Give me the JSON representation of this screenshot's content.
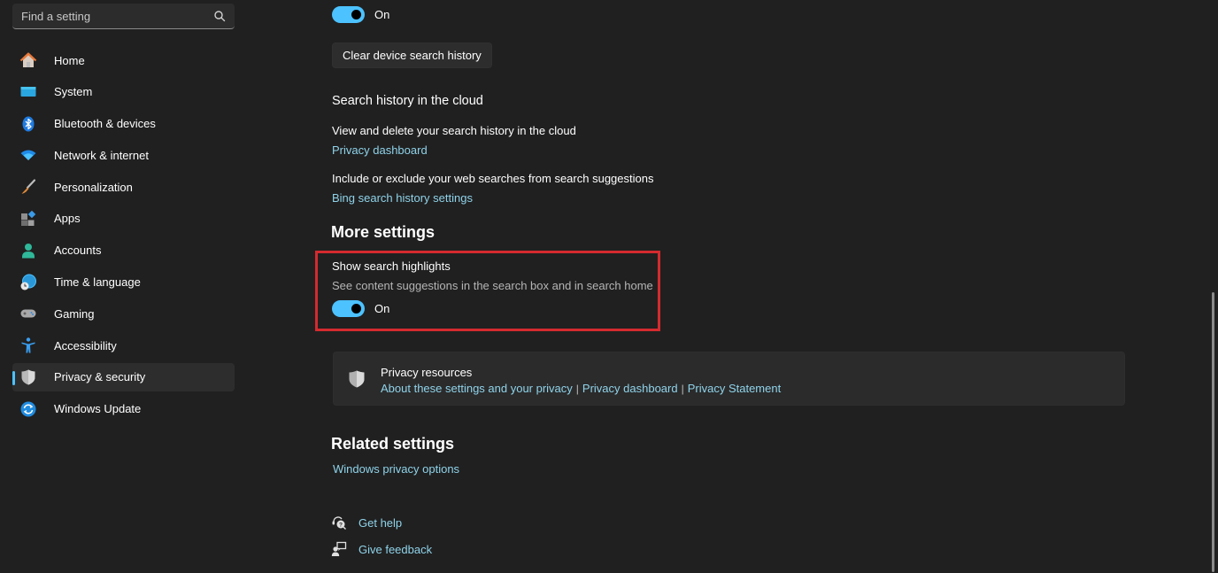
{
  "sidebar": {
    "search": {
      "placeholder": "Find a setting",
      "value": ""
    },
    "items": [
      {
        "label": "Home",
        "icon": "home-icon",
        "selected": false
      },
      {
        "label": "System",
        "icon": "system-icon",
        "selected": false
      },
      {
        "label": "Bluetooth & devices",
        "icon": "bluetooth-icon",
        "selected": false
      },
      {
        "label": "Network & internet",
        "icon": "wifi-icon",
        "selected": false
      },
      {
        "label": "Personalization",
        "icon": "brush-icon",
        "selected": false
      },
      {
        "label": "Apps",
        "icon": "apps-icon",
        "selected": false
      },
      {
        "label": "Accounts",
        "icon": "person-icon",
        "selected": false
      },
      {
        "label": "Time & language",
        "icon": "globe-clock-icon",
        "selected": false
      },
      {
        "label": "Gaming",
        "icon": "gamepad-icon",
        "selected": false
      },
      {
        "label": "Accessibility",
        "icon": "accessibility-icon",
        "selected": false
      },
      {
        "label": "Privacy & security",
        "icon": "shield-icon",
        "selected": true
      },
      {
        "label": "Windows Update",
        "icon": "update-icon",
        "selected": false
      }
    ]
  },
  "main": {
    "history_toggle": {
      "state_label": "On",
      "on": true
    },
    "clear_button_label": "Clear device search history",
    "cloud_history": {
      "heading": "Search history in the cloud",
      "view_delete_text": "View and delete your search history in the cloud",
      "privacy_dashboard_link": "Privacy dashboard",
      "include_exclude_text": "Include or exclude your web searches from search suggestions",
      "bing_link": "Bing search history settings"
    },
    "more_settings": {
      "title": "More settings",
      "highlights_label": "Show search highlights",
      "highlights_description": "See content suggestions in the search box and in search home",
      "highlights_toggle": {
        "state_label": "On",
        "on": true
      }
    },
    "privacy_resources": {
      "title": "Privacy resources",
      "links": [
        "About these settings and your privacy",
        "Privacy dashboard",
        "Privacy Statement"
      ],
      "separator": "|"
    },
    "related_settings": {
      "title": "Related settings",
      "link": "Windows privacy options"
    },
    "help": {
      "get_help": "Get help",
      "give_feedback": "Give feedback"
    }
  },
  "colors": {
    "background": "#202020",
    "accent": "#4cc2ff",
    "link": "#8fd3ea",
    "highlight_border": "#d42a2f"
  }
}
